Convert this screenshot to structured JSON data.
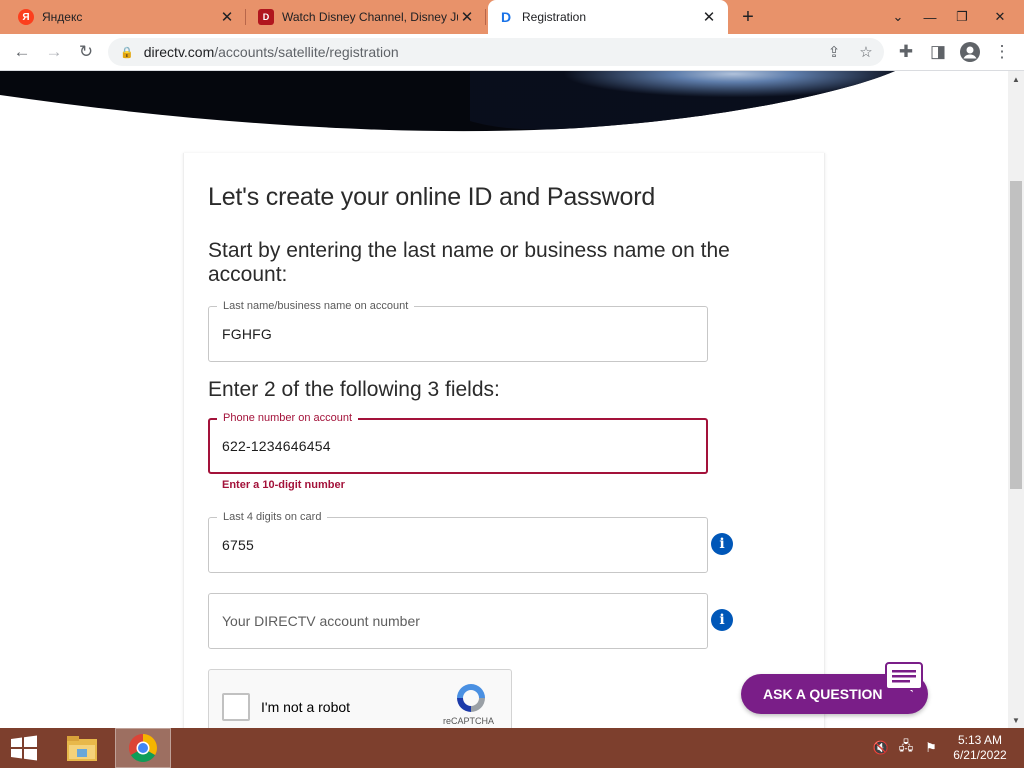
{
  "browser": {
    "tabs": [
      {
        "title": "Яндекс",
        "favicon": "yandex-favicon",
        "active": false
      },
      {
        "title": "Watch Disney Channel, Disney Ju",
        "favicon": "disney-favicon",
        "active": false
      },
      {
        "title": "Registration",
        "favicon": "directv-favicon",
        "active": true
      }
    ],
    "url_host": "directv.com",
    "url_path": "/accounts/satellite/registration"
  },
  "form": {
    "heading": "Let's create your online ID and Password",
    "lastname_prompt": "Start by entering the last name or business name on the account:",
    "lastname_label": "Last name/business name on account",
    "lastname_value": "FGHFG",
    "fields_prompt": "Enter 2 of the following 3 fields:",
    "phone_label": "Phone number on account",
    "phone_value": "622-1234646454",
    "phone_error": "Enter a 10-digit number",
    "card_label": "Last 4 digits on card",
    "card_value": "6755",
    "account_placeholder": "Your DIRECTV account number",
    "info_glyph": "i"
  },
  "captcha": {
    "label": "I'm not a robot",
    "brand": "reCAPTCHA"
  },
  "chat": {
    "label": "ASK A QUESTION"
  },
  "taskbar": {
    "time": "5:13 AM",
    "date": "6/21/2022"
  },
  "colors": {
    "error": "#a3123a",
    "info": "#0057b8",
    "chat": "#7a1e88",
    "tabstrip": "#e8926a",
    "taskbar": "#7d3f2d"
  }
}
